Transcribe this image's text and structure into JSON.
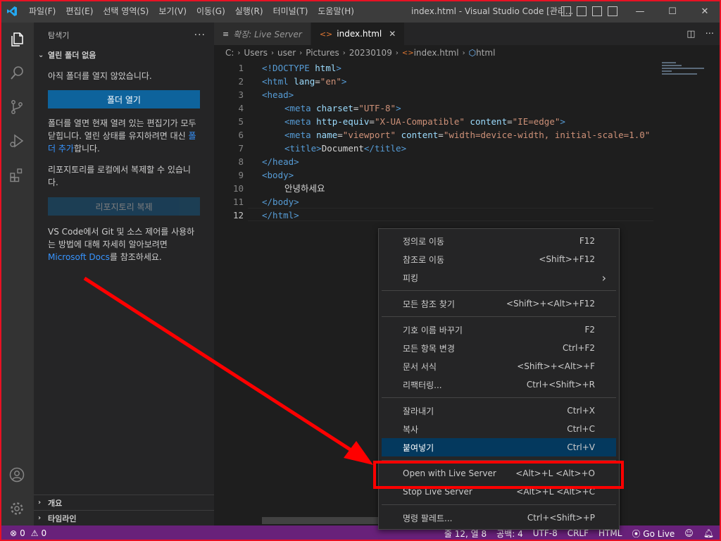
{
  "titlebar": {
    "menus": [
      "파일(F)",
      "편집(E)",
      "선택 영역(S)",
      "보기(V)",
      "이동(G)",
      "실행(R)",
      "터미널(T)",
      "도움말(H)"
    ],
    "title": "index.html - Visual Studio Code [관리...",
    "minimize": "—",
    "maximize": "☐",
    "close": "✕"
  },
  "sidebar": {
    "title": "탐색기",
    "more": "···",
    "section": "열린 폴더 없음",
    "no_folder_text": "아직 폴더를 열지 않았습니다.",
    "open_folder_button": "폴더 열기",
    "folder_desc_1": "폴더를 열면 현재 열려 있는 편집기가 모두 닫힙니다. 열린 상태를 유지하려면 대신 ",
    "add_folder_link": "폴더 추가",
    "folder_desc_2": "합니다.",
    "clone_desc": "리포지토리를 로컬에서 복제할 수 있습니다.",
    "clone_button": "리포지토리 복제",
    "git_desc_1": "VS Code에서 Git 및 소스 제어를 사용하는 방법에 대해 자세히 알아보려면 ",
    "docs_link": "Microsoft Docs",
    "git_desc_2": "를 참조하세요.",
    "outline": "개요",
    "timeline": "타임라인"
  },
  "tabs": [
    {
      "label": "확장: Live Server",
      "active": false,
      "icon": "extension-preview-icon"
    },
    {
      "label": "index.html",
      "active": true,
      "icon": "html-file-icon",
      "close": "✕"
    }
  ],
  "breadcrumbs": [
    "C:",
    "Users",
    "user",
    "Pictures",
    "20230109",
    "index.html",
    "html"
  ],
  "code_lines": [
    {
      "n": "1"
    },
    {
      "n": "2"
    },
    {
      "n": "3"
    },
    {
      "n": "4"
    },
    {
      "n": "5"
    },
    {
      "n": "6"
    },
    {
      "n": "7"
    },
    {
      "n": "8"
    },
    {
      "n": "9"
    },
    {
      "n": "10"
    },
    {
      "n": "11"
    },
    {
      "n": "12"
    }
  ],
  "code": {
    "l1": [
      "<!DOCTYPE ",
      "html",
      ">"
    ],
    "l2": [
      "<html ",
      "lang",
      "=",
      "\"en\"",
      ">"
    ],
    "l3": [
      "<head>"
    ],
    "l4": [
      "<meta ",
      "charset",
      "=",
      "\"UTF-8\"",
      ">"
    ],
    "l5": [
      "<meta ",
      "http-equiv",
      "=",
      "\"X-UA-Compatible\"",
      " ",
      "content",
      "=",
      "\"IE=edge\"",
      ">"
    ],
    "l6": [
      "<meta ",
      "name",
      "=",
      "\"viewport\"",
      " ",
      "content",
      "=",
      "\"width=device-width, initial-scale=1.0\""
    ],
    "l7": [
      "<title>",
      "Document",
      "</title>"
    ],
    "l8": [
      "</head>"
    ],
    "l9": [
      "<body>"
    ],
    "l10": [
      "안녕하세요"
    ],
    "l11": [
      "</body>"
    ],
    "l12": [
      "</html>"
    ]
  },
  "context_menu": {
    "groups": [
      [
        {
          "label": "정의로 이동",
          "key": "F12"
        },
        {
          "label": "참조로 이동",
          "key": "<Shift>+F12"
        },
        {
          "label": "피킹",
          "key": "›"
        }
      ],
      [
        {
          "label": "모든 참조 찾기",
          "key": "<Shift>+<Alt>+F12"
        }
      ],
      [
        {
          "label": "기호 이름 바꾸기",
          "key": "F2"
        },
        {
          "label": "모든 항목 변경",
          "key": "Ctrl+F2"
        },
        {
          "label": "문서 서식",
          "key": "<Shift>+<Alt>+F"
        },
        {
          "label": "리팩터링...",
          "key": "Ctrl+<Shift>+R"
        }
      ],
      [
        {
          "label": "잘라내기",
          "key": "Ctrl+X"
        },
        {
          "label": "복사",
          "key": "Ctrl+C"
        },
        {
          "label": "붙여넣기",
          "key": "Ctrl+V",
          "highlighted": true
        }
      ],
      [
        {
          "label": "Open with Live Server",
          "key": "<Alt>+L <Alt>+O"
        },
        {
          "label": "Stop Live Server",
          "key": "<Alt>+L <Alt>+C"
        }
      ],
      [
        {
          "label": "명령 팔레트...",
          "key": "Ctrl+<Shift>+P"
        }
      ]
    ]
  },
  "statusbar": {
    "errors": "0",
    "warnings": "0",
    "position": "줄 12, 열 8",
    "spaces": "공백: 4",
    "encoding": "UTF-8",
    "eol": "CRLF",
    "language": "HTML",
    "golive": "Go Live"
  },
  "colors": {
    "statusbar": "#68217a",
    "accent": "#0e639c",
    "highlight_box": "#ff0000"
  }
}
